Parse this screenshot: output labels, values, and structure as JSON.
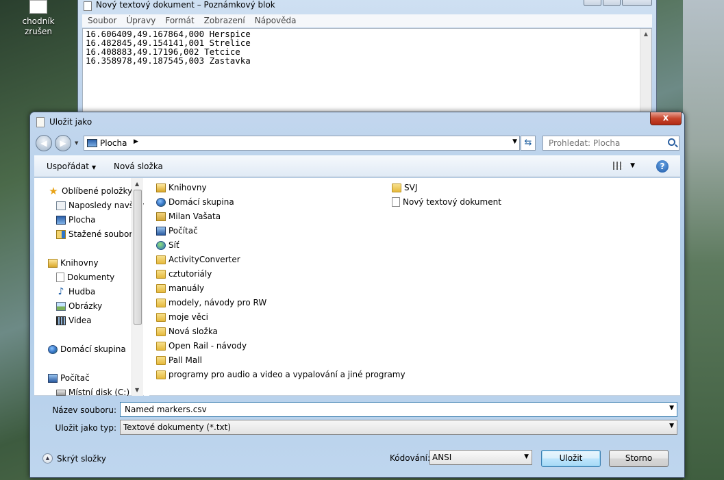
{
  "desktop": {
    "icon_label": "chodník zrušen"
  },
  "notepad": {
    "title": "Nový textový dokument – Poznámkový blok",
    "menu": [
      "Soubor",
      "Úpravy",
      "Formát",
      "Zobrazení",
      "Nápověda"
    ],
    "content": "16.606409,49.167864,000 Herspice\n16.482845,49.154141,001 Strelice\n16.408883,49.17196,002 Tetcice\n16.358978,49.187545,003 Zastavka"
  },
  "dialog": {
    "title": "Uložit jako",
    "close_label": "x",
    "address": {
      "location": "Plocha"
    },
    "search": {
      "placeholder": "Prohledat: Plocha"
    },
    "toolbar": {
      "organize_label": "Uspořádat",
      "new_folder_label": "Nová složka",
      "help_label": "?"
    },
    "nav": [
      "Oblíbené položky",
      "Naposledy navštívené",
      "Plocha",
      "Stažené soubory",
      "Knihovny",
      "Dokumenty",
      "Hudba",
      "Obrázky",
      "Videa",
      "Domácí skupina",
      "Počítač",
      "Místní disk (C:)"
    ],
    "files_col1": [
      "Knihovny",
      "Domácí skupina",
      "Milan Vašata",
      "Počítač",
      "Síť",
      "ActivityConverter",
      "cztutoriály",
      "manuály",
      "modely, návody pro RW",
      "moje věci",
      "Nová složka",
      "Open Rail - návody",
      "Pall Mall",
      "programy pro  audio a video a vypalování a jiné programy"
    ],
    "files_col2": [
      "SVJ",
      "Nový textový dokument"
    ],
    "filename": {
      "label": "Název souboru:",
      "value": "Named markers.csv"
    },
    "filetype": {
      "label": "Uložit jako typ:",
      "value": "Textové dokumenty (*.txt)"
    },
    "hide_folders_label": "Skrýt složky",
    "encoding": {
      "label": "Kódování:",
      "value": "ANSI"
    },
    "save_label": "Uložit",
    "cancel_label": "Storno"
  }
}
